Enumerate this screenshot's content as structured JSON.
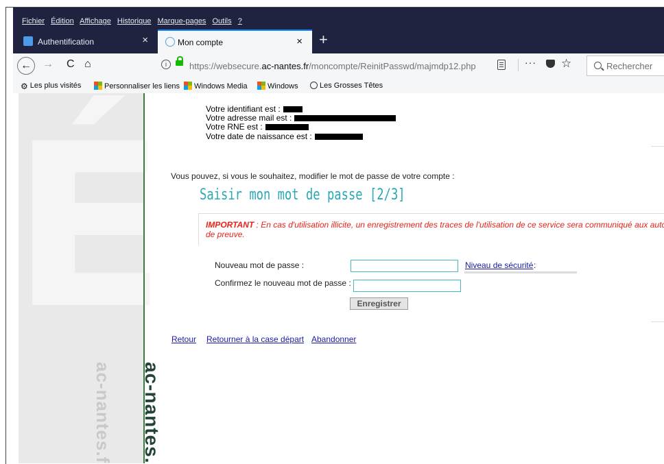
{
  "menu": [
    "Fichier",
    "Édition",
    "Affichage",
    "Historique",
    "Marque-pages",
    "Outils",
    "?"
  ],
  "tabs": [
    {
      "title": "Authentification",
      "close": "×"
    },
    {
      "title": "Mon compte",
      "close": "×"
    }
  ],
  "new_tab": "+",
  "nav": {
    "back": "←",
    "forward": "→",
    "reload": "C",
    "home": "⌂",
    "url_prefix": "https://websecure.",
    "url_domain": "ac-nantes.fr",
    "url_path": "/moncompte/ReinitPasswd/majmdp12.php",
    "more": "···",
    "star": "☆",
    "search_label": "Rechercher"
  },
  "bookmarks": [
    "Les plus visités",
    "Personnaliser les liens",
    "Windows Media",
    "Windows",
    "Les Grosses Têtes"
  ],
  "page": {
    "side_watermark": "ac-nantes.fr",
    "info": [
      "Votre identifiant est :",
      "Votre adresse mail est :",
      "Votre RNE est :",
      "Votre date de naissance est :"
    ],
    "intro": "Vous pouvez, si vous le souhaitez, modifier le mot de passe de votre compte :",
    "step_title": "Saisir mon mot de passe [2/3]",
    "warning_strong": "IMPORTANT",
    "warning_text": " : En cas d'utilisation illicite, un enregistrement des traces de l'utilisation de ce service sera communiqué aux autor de preuve.",
    "new_password_label": "Nouveau mot de passe :",
    "confirm_password_label": "Confirmez le nouveau mot de passe :",
    "security_level_link": "Niveau de sécurité",
    "security_level_colon": ":",
    "save_button": "Enregistrer",
    "links": [
      "Retour",
      "Retourner à la case départ",
      "Abandonner"
    ]
  },
  "colors": {
    "menu_bg": "#202340",
    "accent_tab": "#0a84ff",
    "title_teal": "#2aa8b6",
    "warning_red": "#e8231a",
    "link_blue": "#1a1aa6"
  }
}
